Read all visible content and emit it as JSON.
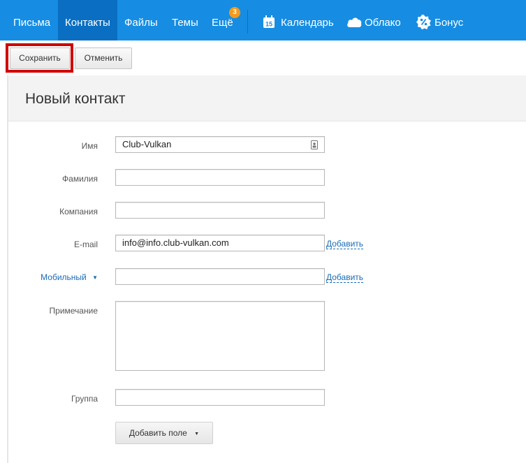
{
  "nav": {
    "items": [
      {
        "label": "Письма"
      },
      {
        "label": "Контакты",
        "active": true
      },
      {
        "label": "Файлы"
      },
      {
        "label": "Темы"
      },
      {
        "label": "Ещё",
        "badge": "3"
      }
    ],
    "apps": [
      {
        "label": "Календарь",
        "icon": "calendar-icon",
        "icon_text": "15"
      },
      {
        "label": "Облако",
        "icon": "cloud-icon"
      },
      {
        "label": "Бонус",
        "icon": "bonus-icon"
      }
    ],
    "colors": {
      "bar": "#168de2",
      "active": "#0a6fc2",
      "badge": "#f59a1e"
    }
  },
  "toolbar": {
    "save_label": "Сохранить",
    "cancel_label": "Отменить",
    "highlight_color": "#d10000"
  },
  "page": {
    "title": "Новый контакт"
  },
  "form": {
    "name": {
      "label": "Имя",
      "value": "Club-Vulkan"
    },
    "surname": {
      "label": "Фамилия",
      "value": ""
    },
    "company": {
      "label": "Компания",
      "value": ""
    },
    "email": {
      "label": "E-mail",
      "value": "info@info.club-vulkan.com",
      "add_label": "Добавить"
    },
    "phone": {
      "label": "Мобильный",
      "value": "",
      "add_label": "Добавить"
    },
    "note": {
      "label": "Примечание",
      "value": ""
    },
    "group": {
      "label": "Группа",
      "value": ""
    },
    "add_field_label": "Добавить поле"
  }
}
